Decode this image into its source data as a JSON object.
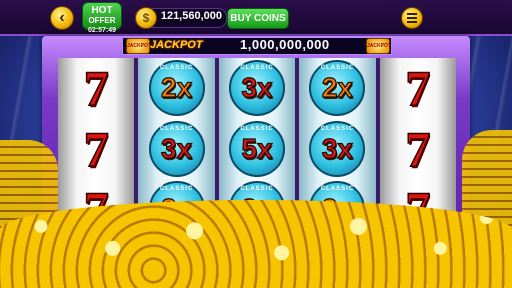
{
  "topbar": {
    "hot_offer_line1": "HOT",
    "hot_offer_line2": "OFFER",
    "timer": "02:57:49",
    "coin_symbol": "$",
    "coin_balance": "121,560,000",
    "buy_coins_label": "BUY COINS",
    "back_icon": "back-arrow-icon",
    "menu_icon": "hamburger-menu-icon"
  },
  "jackpot": {
    "label": "JACKPOT",
    "amount": "1,000,000,000",
    "badge_text": "JACKPOT"
  },
  "reels": [
    {
      "type": "seven",
      "symbols": [
        "7",
        "7",
        "7"
      ]
    },
    {
      "type": "multiplier",
      "symbols": [
        "2x",
        "3x",
        "2x"
      ],
      "ribbon": "CLASSIC"
    },
    {
      "type": "multiplier",
      "symbols": [
        "3x",
        "5x",
        "3x"
      ],
      "ribbon": "CLASSIC"
    },
    {
      "type": "multiplier",
      "symbols": [
        "2x",
        "3x",
        "2x"
      ],
      "ribbon": "CLASSIC"
    },
    {
      "type": "seven",
      "symbols": [
        "7",
        "7",
        "7"
      ]
    }
  ],
  "colors": {
    "seven_red": "#e0140f",
    "multiplier_orange": "#f07a10",
    "multiplier_red": "#e0141a",
    "buy_button_green": "#149a14",
    "jackpot_gold": "#ffd21f"
  }
}
